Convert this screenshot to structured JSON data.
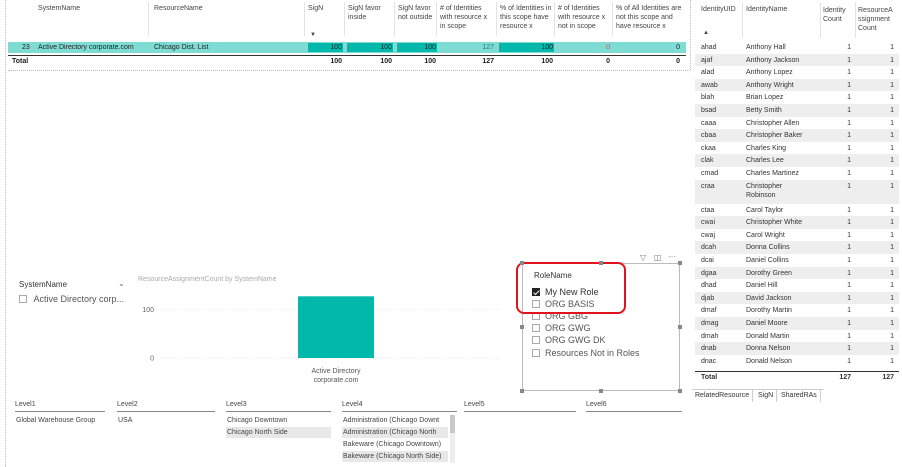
{
  "top_table": {
    "headers": {
      "system_name": "SystemName",
      "resource_name": "ResourceName",
      "sign": "SigN",
      "sign_favor_inside": "SigN favor inside",
      "sign_favor_not_outside": "SigN favor not outside",
      "identities_in_scope": "# of Identities with resource x in scope",
      "pct_in_scope": "% of Identities in this scope have resource x",
      "identities_not_in_scope": "# of Identities with resource x not in scope",
      "pct_all_not_scope": "% of All Identities are not this scope and have resource x"
    },
    "row": {
      "index": "23",
      "system": "Active Directory corporate.com",
      "resource": "Chicago Dist. List",
      "sign": "100",
      "sign_favor_inside": "100",
      "sign_favor_not_outside": "100",
      "identities_in_scope": "127",
      "pct_in_scope": "100",
      "identities_not_in_scope": "0",
      "pct_all_not_scope": "0"
    },
    "total": {
      "label": "Total",
      "sign": "100",
      "sign_favor_inside": "100",
      "sign_favor_not_outside": "100",
      "identities_in_scope": "127",
      "pct_in_scope": "100",
      "identities_not_in_scope": "0",
      "pct_all_not_scope": "0"
    }
  },
  "identity_table": {
    "headers": {
      "uid": "IdentityUID",
      "name": "IdentityName",
      "count": "Identity Count",
      "assign": "ResourceA ssignment Count"
    },
    "rows": [
      {
        "uid": "ahad",
        "name": "Anthony Hall",
        "count": "1",
        "assign": "1"
      },
      {
        "uid": "ajaf",
        "name": "Anthony Jackson",
        "count": "1",
        "assign": "1"
      },
      {
        "uid": "alad",
        "name": "Anthony Lopez",
        "count": "1",
        "assign": "1"
      },
      {
        "uid": "awab",
        "name": "Anthony Wright",
        "count": "1",
        "assign": "1"
      },
      {
        "uid": "blah",
        "name": "Brian Lopez",
        "count": "1",
        "assign": "1"
      },
      {
        "uid": "bsad",
        "name": "Betty Smith",
        "count": "1",
        "assign": "1"
      },
      {
        "uid": "caaa",
        "name": "Christopher Allen",
        "count": "1",
        "assign": "1"
      },
      {
        "uid": "cbaa",
        "name": "Christopher Baker",
        "count": "1",
        "assign": "1"
      },
      {
        "uid": "ckaa",
        "name": "Charles King",
        "count": "1",
        "assign": "1"
      },
      {
        "uid": "clak",
        "name": "Charles Lee",
        "count": "1",
        "assign": "1"
      },
      {
        "uid": "cmad",
        "name": "Charles Martinez",
        "count": "1",
        "assign": "1"
      },
      {
        "uid": "craa",
        "name": "Christopher Robinson",
        "count": "1",
        "assign": "1"
      },
      {
        "uid": "ctaa",
        "name": "Carol Taylor",
        "count": "1",
        "assign": "1"
      },
      {
        "uid": "cwai",
        "name": "Christopher White",
        "count": "1",
        "assign": "1"
      },
      {
        "uid": "cwaj",
        "name": "Carol Wright",
        "count": "1",
        "assign": "1"
      },
      {
        "uid": "dcah",
        "name": "Donna Collins",
        "count": "1",
        "assign": "1"
      },
      {
        "uid": "dcai",
        "name": "Daniel Collins",
        "count": "1",
        "assign": "1"
      },
      {
        "uid": "dgaa",
        "name": "Dorothy Green",
        "count": "1",
        "assign": "1"
      },
      {
        "uid": "dhad",
        "name": "Daniel Hill",
        "count": "1",
        "assign": "1"
      },
      {
        "uid": "djab",
        "name": "David Jackson",
        "count": "1",
        "assign": "1"
      },
      {
        "uid": "dmaf",
        "name": "Dorothy Martin",
        "count": "1",
        "assign": "1"
      },
      {
        "uid": "dmag",
        "name": "Daniel Moore",
        "count": "1",
        "assign": "1"
      },
      {
        "uid": "dmah",
        "name": "Donald Martin",
        "count": "1",
        "assign": "1"
      },
      {
        "uid": "dnab",
        "name": "Donna Nelson",
        "count": "1",
        "assign": "1"
      },
      {
        "uid": "dnac",
        "name": "Donald Nelson",
        "count": "1",
        "assign": "1"
      }
    ],
    "total": {
      "label": "Total",
      "count": "127",
      "assign": "127"
    }
  },
  "system_slicer": {
    "title": "SystemName",
    "item": "Active Directory corp..."
  },
  "chart_data": {
    "type": "bar",
    "title": "ResourceAssignmentCount by SystemName",
    "categories": [
      "Active Directory corporate.com"
    ],
    "values": [
      127
    ],
    "ylim": [
      0,
      140
    ],
    "yticks": [
      "100",
      "0"
    ],
    "ytick_values": [
      100,
      0
    ],
    "bar_color": "#01b8aa",
    "grid": true
  },
  "role_slicer": {
    "title": "RoleName",
    "items": [
      {
        "label": "My New Role",
        "checked": true
      },
      {
        "label": "ORG BASIS",
        "checked": false
      },
      {
        "label": "ORG GBG",
        "checked": false
      },
      {
        "label": "ORG GWG",
        "checked": false
      },
      {
        "label": "ORG GWG DK",
        "checked": false
      },
      {
        "label": "Resources Not in Roles",
        "checked": false
      }
    ],
    "highlight_color": "#e0141e"
  },
  "level_slicers": [
    {
      "title": "Level1",
      "values": [
        "Global Warehouse Group"
      ]
    },
    {
      "title": "Level2",
      "values": [
        "USA"
      ]
    },
    {
      "title": "Level3",
      "values": [
        "Chicago Downtown",
        "Chicago North Side"
      ]
    },
    {
      "title": "Level4",
      "values": [
        "Administration (Chicago Downt",
        "Administration (Chicago North",
        "Bakeware (Chicago Downtown)",
        "Bakeware (Chicago North Side)"
      ]
    },
    {
      "title": "Level5",
      "values": []
    },
    {
      "title": "Level6",
      "values": []
    }
  ],
  "bottom_tabs": [
    "RelatedResource",
    "SigN",
    "SharedRAs"
  ],
  "colors": {
    "accent": "#01b8aa",
    "selected_row": "#7fdcd4"
  }
}
